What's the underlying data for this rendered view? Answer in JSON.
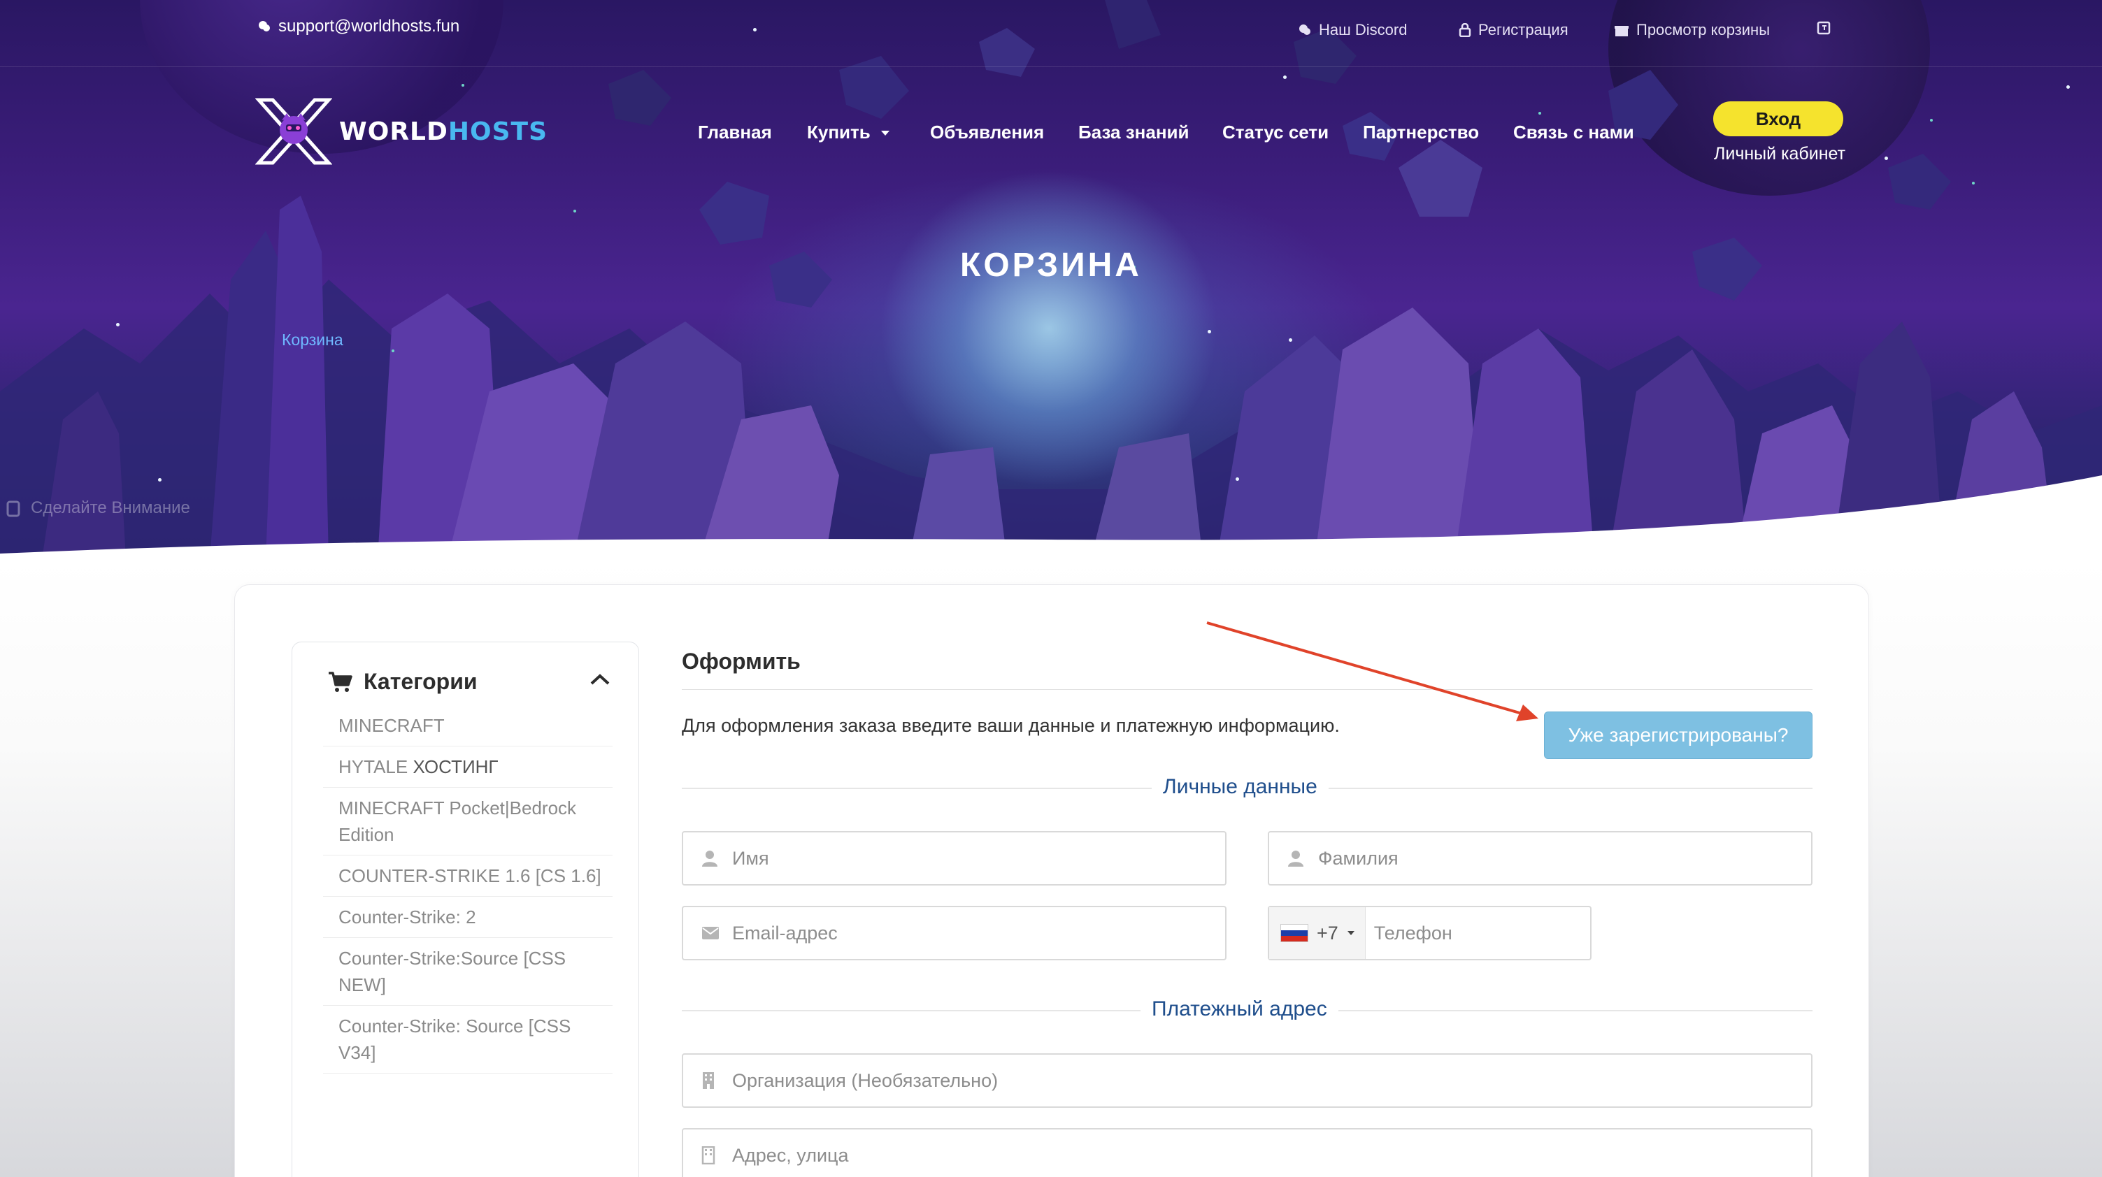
{
  "topbar": {
    "email": "support@worldhosts.fun",
    "discord": "Наш Discord",
    "register": "Регистрация",
    "view_cart": "Просмотр корзины"
  },
  "logo": {
    "part1": "WORLD",
    "part2": "HOSTS"
  },
  "nav": {
    "home": "Главная",
    "buy": "Купить",
    "announcements": "Объявления",
    "knowledgebase": "База знаний",
    "network_status": "Статус сети",
    "partnership": "Партнерство",
    "contact": "Связь с нами"
  },
  "login": {
    "label": "Вход",
    "cabinet": "Личный кабинет"
  },
  "hero": {
    "title": "КОРЗИНА",
    "breadcrumb": "Корзина",
    "ghost_text": "Сделайте Внимание"
  },
  "sidebar": {
    "title": "Категории",
    "items": [
      {
        "label": "MINECRAFT"
      },
      {
        "label": "HYTALE",
        "bold": "ХОСТИНГ"
      },
      {
        "label": "MINECRAFT Pocket|Bedrock Edition"
      },
      {
        "label": "COUNTER-STRIKE 1.6 [CS 1.6]"
      },
      {
        "label": "Counter-Strike: 2"
      },
      {
        "label": "Counter-Strike:Source [CSS NEW]"
      },
      {
        "label": "Counter-Strike: Source [CSS V34]"
      }
    ]
  },
  "checkout": {
    "title": "Оформить",
    "description": "Для оформления заказа введите ваши данные и платежную информацию.",
    "already_registered": "Уже зарегистрированы?",
    "personal_section": "Личные данные",
    "billing_section": "Платежный адрес",
    "fields": {
      "first_name": "Имя",
      "last_name": "Фамилия",
      "email": "Email-адрес",
      "phone_code": "+7",
      "phone": "Телефон",
      "company": "Организация (Необязательно)",
      "address": "Адрес, улица"
    }
  },
  "colors": {
    "accent_yellow": "#f5e32d",
    "button_blue": "#7ec0e2",
    "section_title": "#1f4e8c",
    "annotation_arrow": "#e0432a"
  }
}
